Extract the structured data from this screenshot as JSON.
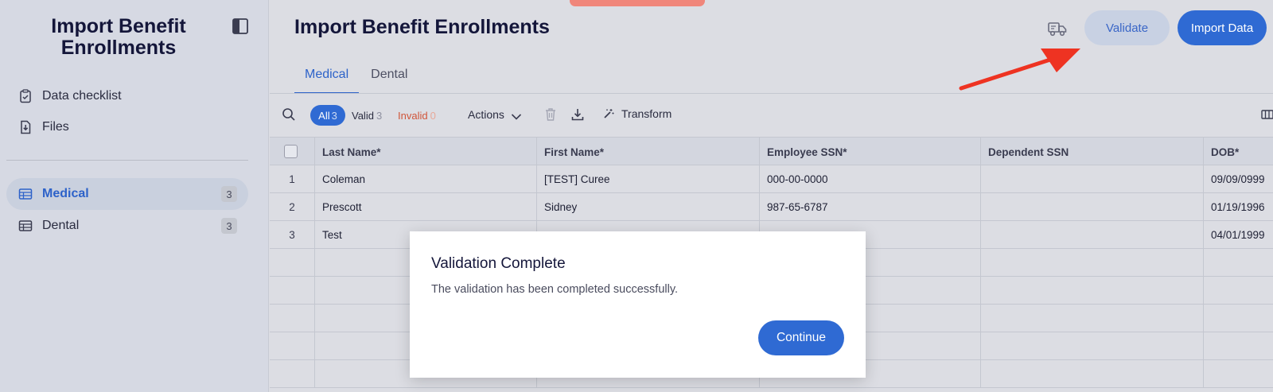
{
  "app": {
    "title": "Import Benefit Enrollments"
  },
  "sidebar": {
    "links": [
      {
        "label": "Data checklist",
        "icon": "clipboard-check-icon"
      },
      {
        "label": "Files",
        "icon": "file-import-icon"
      }
    ],
    "sheets": [
      {
        "label": "Medical",
        "count": "3",
        "active": true,
        "icon": "table-icon"
      },
      {
        "label": "Dental",
        "count": "3",
        "active": false,
        "icon": "table-icon"
      }
    ]
  },
  "header": {
    "title": "Import Benefit Enrollments",
    "validate_label": "Validate",
    "import_label": "Import Data"
  },
  "tabs": [
    {
      "label": "Medical",
      "active": true
    },
    {
      "label": "Dental",
      "active": false
    }
  ],
  "toolbar": {
    "all_label": "All",
    "all_count": "3",
    "valid_label": "Valid",
    "valid_count": "3",
    "invalid_label": "Invalid",
    "invalid_count": "0",
    "actions_label": "Actions",
    "transform_label": "Transform"
  },
  "table": {
    "columns": [
      "Last Name*",
      "First Name*",
      "Employee SSN*",
      "Dependent SSN",
      "DOB*"
    ],
    "rows": [
      {
        "num": "1",
        "cells": [
          "Coleman",
          "[TEST] Curee",
          "000-00-0000",
          "",
          "09/09/0999"
        ]
      },
      {
        "num": "2",
        "cells": [
          "Prescott",
          "Sidney",
          "987-65-6787",
          "",
          "01/19/1996"
        ]
      },
      {
        "num": "3",
        "cells": [
          "Test",
          "",
          "",
          "",
          "04/01/1999"
        ]
      }
    ]
  },
  "modal": {
    "title": "Validation Complete",
    "message": "The validation has been completed successfully.",
    "continue_label": "Continue"
  },
  "colors": {
    "accent": "#2f6ad3",
    "invalid": "#d0553a",
    "annotation_arrow": "#ee3322"
  }
}
